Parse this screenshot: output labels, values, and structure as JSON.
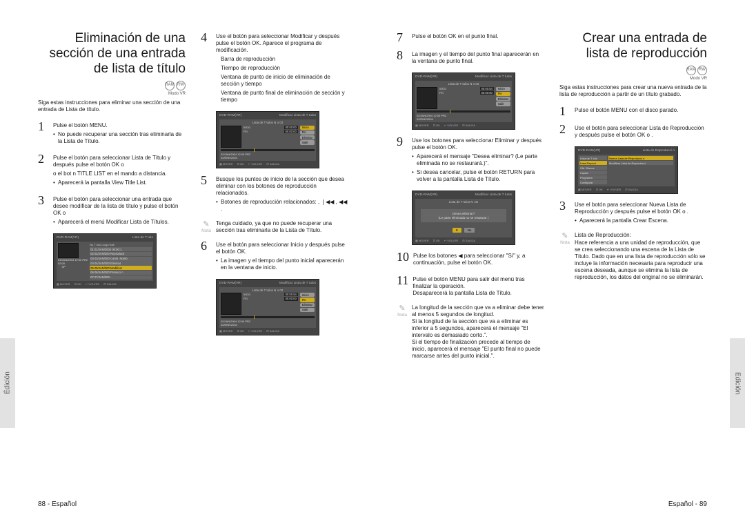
{
  "left_page": {
    "side_tab": "Édición",
    "footer": "88 - Español",
    "col1": {
      "section_title": "Eliminación de una sección de una entrada de lista de título",
      "disc_icons": [
        "RAM",
        "RW"
      ],
      "mode": "Modo VR",
      "intro": "Siga estas instrucciones para eliminar una sección de una entrada de Lista de título.",
      "steps": {
        "s1": {
          "num": "1",
          "line1": "Pulse el botón MENU.",
          "bullet1": "No puede recuperar una sección tras eliminarla de la Lista de Título."
        },
        "s2": {
          "num": "2",
          "line1": "Pulse el botón        para seleccionar Lista de Título y después pulse el botón OK o",
          "line2": "o el bot   n TITLE LIST en el mando a distancia.",
          "bullet1": "Aparecerá la pantalla View Title List."
        },
        "s3": {
          "num": "3",
          "line1": "Pulse el botón        para seleccionar una entrada que desee modificar de la lista de título y pulse el botón OK o",
          "bullet1": "Aparecerá el menú Modificar Lista de Títulos."
        }
      },
      "screenshot1": {
        "head_l": "DVD-RAM(VR)",
        "head_r": "Lista de T  tulo",
        "sub": "No   T tulo    Largo  Edit",
        "rows": [
          "01 01/JAN/2004 00:00:1",
          "02 02/JAN/200 Reproducir",
          "03 03/JAN/200 Camb. Nomb.",
          "04 04/JAN/200 Eliminar",
          "05 05/JAN/200 Modificar",
          "06 06/JAN/200 Protecci n",
          "07 07/JAN/200 -"
        ],
        "hl_idx": 4,
        "thumb_caption": "03/JAN/2004 12:00 PR2\n02:00\n     SP",
        "nav": [
          "MOVER",
          "OK",
          "VOLVER",
          "SALIDA"
        ]
      }
    },
    "col2": {
      "steps": {
        "s4": {
          "num": "4",
          "line1": "Use el botón        para seleccionar Modificar y después pulse el botón OK. Aparece el programa de modificación.",
          "sub_items": [
            "Barra de reproducción",
            "Tiempo de reproducción",
            "Ventana de punto de inicio de eliminación de sección y tiempo",
            "Ventana de punto final de eliminación de sección y tiempo"
          ]
        },
        "s5": {
          "num": "5",
          "line1": "Busque los puntos de inicio de la sección que desea eliminar con los botones de reproducción relacionados.",
          "bullet1": "Botones de reproducción relacionados:   , ❘◀◀ , ◀◀ ."
        },
        "s6": {
          "num": "6",
          "line1": "Use el botón        para seleccionar Inicio y después pulse el botón OK.",
          "bullet1": "La imagen y el tiempo del punto inicial aparecerán en la ventana de inicio."
        }
      },
      "note1": {
        "label": "Nota",
        "text": "Tenga cuidado, ya que no puede recuperar una sección tras eliminarla de la Lista de Título."
      },
      "screenshot_mod": {
        "head_l": "DVD-RAM(VR)",
        "head_r": "Modificar Lista de T  tulos",
        "sub": "Lista de T  tulos  N o 02",
        "inicio_l": "Inicio",
        "inicio_v": "00:00:00",
        "fin_l": "Fin",
        "fin_v": "00:00:00",
        "btns": [
          "Inicio",
          "Fin",
          "Eliminar",
          "Salir"
        ],
        "thumb_caption": "02/JAN/2004 12:00 PR2\n02/ENE/2004",
        "nav": [
          "MOVER",
          "OK",
          "VOLVER",
          "SALIDA"
        ]
      },
      "screenshot_mod2": {
        "inicio_v": "00:00:54",
        "fin_v": "00:00:00"
      }
    }
  },
  "right_page": {
    "side_tab": "Edición",
    "footer": "Español - 89",
    "col1": {
      "steps": {
        "s7": {
          "num": "7",
          "line1": "Pulse el botón OK en el punto final."
        },
        "s8": {
          "num": "8",
          "line1": "La imagen y el tiempo del punto final aparecerán en la ventana de punto final."
        },
        "s9": {
          "num": "9",
          "line1": "Use los botones        para seleccionar Eliminar y después pulse el botón OK.",
          "bullet1": "Aparecerá el mensaje \"Desea eliminar? (Le parte eliminada no se restaurará.)\".",
          "bullet2": "Si desea cancelar, pulse el botón RETURN para volver a la pantalla Lista de Título."
        },
        "s10": {
          "num": "10",
          "line1": "Pulse los botones  ◀    para seleccionar \"Sí\" y, a continuación, pulse el botón OK."
        },
        "s11": {
          "num": "11",
          "line1": "Pulse el botón MENU para salir del menú tras finalizar la operación.\nDesaparecerá la pantalla Lista de Título."
        }
      },
      "note2": {
        "label": "Nota",
        "text": "La longitud de la sección que va a eliminar debe tener al menos 5 segundos de longitud.\nSi la longitud de la sección que va a eliminar es inferior a 5 segundos, aparecerá el mensaje \"El intervalo es demasiado corto.\".\nSi el tiempo de finalización precede al tiempo de inicio, aparecerá el mensaje \"El punto final no puede marcarse antes del punto inicial.\"."
      },
      "screenshot_fin": {
        "head_l": "DVD-RAM(VR)",
        "head_r": "Modificar Lista de T  tulos",
        "sub": "Lista de T  tulos  N o 02",
        "inicio_l": "Inicio",
        "inicio_v": "00:00:54",
        "fin_l": "Fin",
        "fin_v": "00:00:00",
        "btns": [
          "Inicio",
          "Fin",
          "Eliminar",
          "Salir"
        ],
        "thumb_caption": "02/JAN/2004 12:00 PR2\n02/ENE/2004",
        "nav": [
          "MOVER",
          "OK",
          "VOLVER",
          "SALIDA"
        ]
      },
      "screenshot_confirm": {
        "head_l": "DVD-RAM(VR)",
        "head_r": "Modificar Lista de T  tulos",
        "sub": "Lista de T  tulos  N .02",
        "msg": "Desea eliminar?\n(Le parte eliminada no se restaurar )",
        "choices": [
          "S ",
          "No"
        ],
        "nav": [
          "MOVER",
          "OK",
          "VOLVER",
          "SALIDA"
        ]
      }
    },
    "col2": {
      "section_title": "Crear una entrada de lista de reproducción",
      "disc_icons": [
        "RAM",
        "RW"
      ],
      "mode": "Modo VR",
      "intro": "Siga estas instrucciones para crear una nueva entrada de la lista de reproducción a partir de un título grabado.",
      "steps": {
        "s1": {
          "num": "1",
          "line1": "Pulse el botón MENU con el disco parado."
        },
        "s2": {
          "num": "2",
          "line1": "Use el botón        para seleccionar Lista de Reproducción y después pulse el botón OK o   ."
        },
        "s3": {
          "num": "3",
          "line1": "Use el botón        para seleccionar Nueva Lista de Reproducción y después pulse el botón OK o  .",
          "bullet1": "Aparecerá la pantalla Crear Escena."
        }
      },
      "note3": {
        "label": "Nota",
        "heading": "Lista de Reproducción:",
        "text": "Hace referencia a una unidad de reproducción, que se crea seleccionando una escena de la Lista de Título. Dado que en una lista de reproducción sólo se incluye la información necesaria para reproducir una escena deseada, aunque se elimina la lista de reproducción, los datos del original no se eliminarán."
      },
      "screenshot_menu": {
        "head_l": "DVD-RAM(VR)",
        "head_r": "Lista de Reproducci  n",
        "side_items": [
          "Lista de  T tulo",
          "Lista Reprod.",
          "Ctrl. Discos",
          "Copiar",
          "Programa",
          "Configurar"
        ],
        "side_hl": 1,
        "main_items": [
          "Nueva Lista de Reproducci  n",
          "Modificar Lista de Reproducci"
        ],
        "main_hl": 0,
        "nav": [
          "MOVER",
          "OK",
          "VOLVER",
          "SALIDA"
        ]
      }
    }
  }
}
